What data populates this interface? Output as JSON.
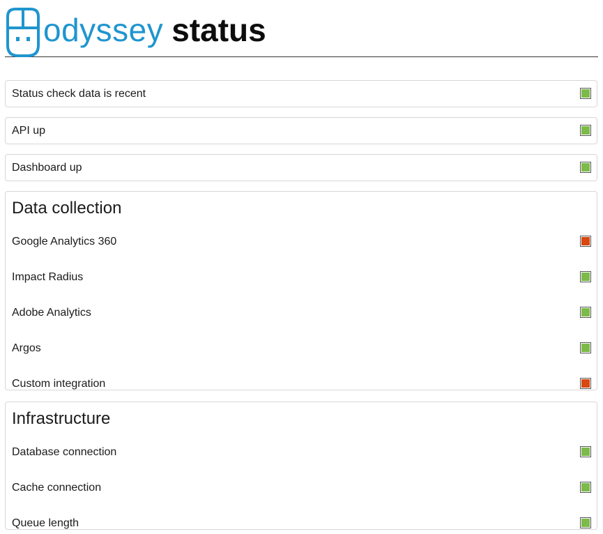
{
  "header": {
    "brand_name": "odyssey",
    "brand_suffix": "status",
    "logo_icon": "odyssey-face-icon",
    "brand_color": "#1f95cf"
  },
  "status_colors": {
    "ok": "#7cbb4a",
    "error": "#d8480f"
  },
  "top_checks": [
    {
      "label": "Status check data is recent",
      "status": "ok"
    },
    {
      "label": "API up",
      "status": "ok"
    },
    {
      "label": "Dashboard up",
      "status": "ok"
    }
  ],
  "groups": [
    {
      "title": "Data collection",
      "items": [
        {
          "label": "Google Analytics 360",
          "status": "error"
        },
        {
          "label": "Impact Radius",
          "status": "ok"
        },
        {
          "label": "Adobe Analytics",
          "status": "ok"
        },
        {
          "label": "Argos",
          "status": "ok"
        },
        {
          "label": "Custom integration",
          "status": "error"
        }
      ]
    },
    {
      "title": "Infrastructure",
      "items": [
        {
          "label": "Database connection",
          "status": "ok"
        },
        {
          "label": "Cache connection",
          "status": "ok"
        },
        {
          "label": "Queue length",
          "status": "ok"
        }
      ]
    }
  ]
}
